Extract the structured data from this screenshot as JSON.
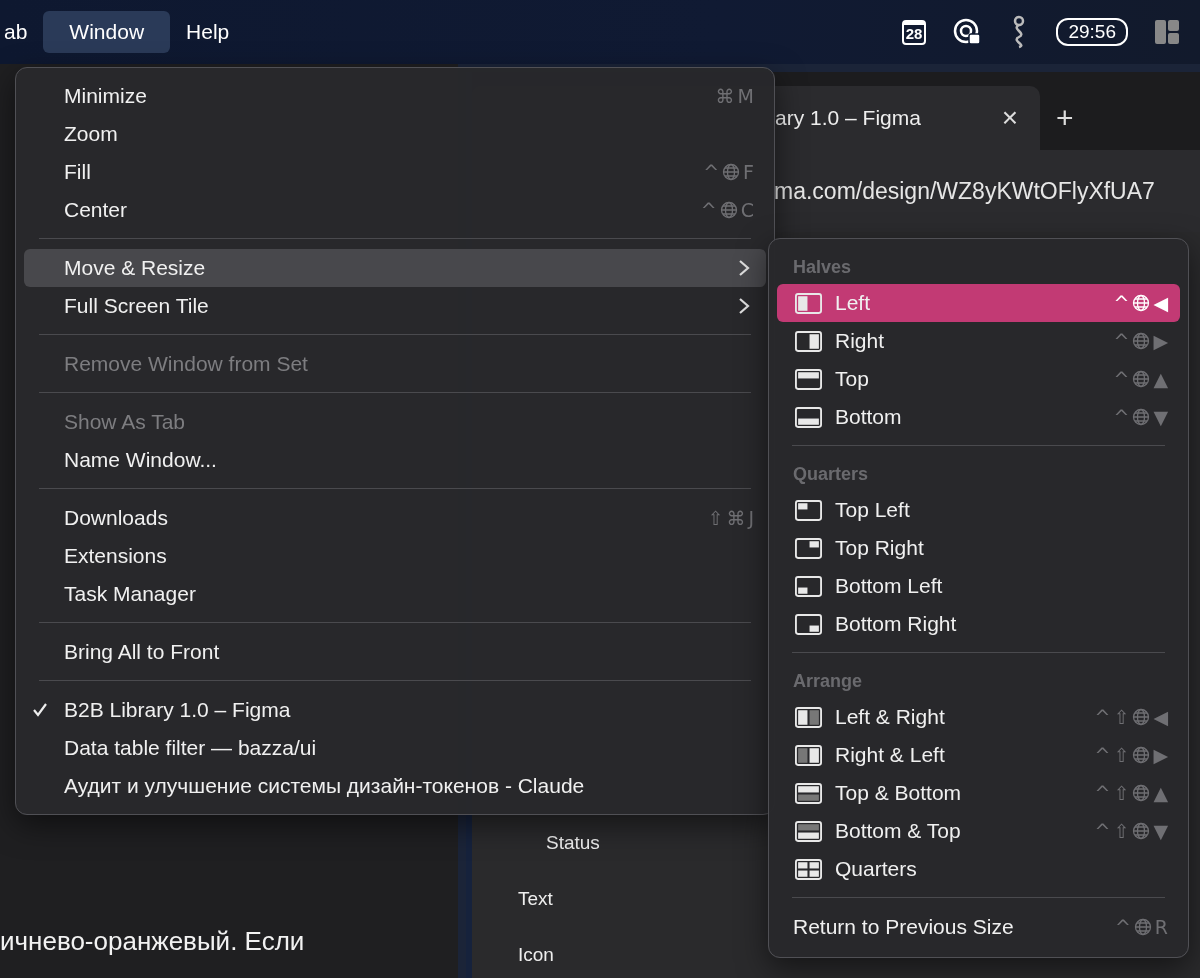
{
  "menu_bar": {
    "items": [
      {
        "label": "ab",
        "selected": false
      },
      {
        "label": "Window",
        "selected": true
      },
      {
        "label": "Help",
        "selected": false
      }
    ],
    "status": {
      "calendar_day": "28",
      "timer": "29:56"
    }
  },
  "browser": {
    "tab": {
      "title": "ary 1.0 – Figma",
      "close": "×"
    },
    "new_tab": "+",
    "url": "ma.com/design/WZ8yKWtOFlyXfUA7",
    "layers": [
      {
        "label": "Status",
        "kind": "nested"
      },
      {
        "label": "Text",
        "kind": "top"
      },
      {
        "label": "Icon",
        "kind": "top"
      }
    ]
  },
  "chat": {
    "text": "ичнево-оранжевый. Если"
  },
  "window_menu": [
    {
      "kind": "item",
      "label": "Minimize",
      "disabled": false,
      "checked": false,
      "selected": false,
      "submenu": false,
      "shortcut": [
        {
          "kind": "key",
          "text": "⌘"
        },
        {
          "kind": "key",
          "text": "M"
        }
      ]
    },
    {
      "kind": "item",
      "label": "Zoom",
      "disabled": false,
      "checked": false,
      "selected": false,
      "submenu": false
    },
    {
      "kind": "item",
      "label": "Fill",
      "disabled": false,
      "checked": false,
      "selected": false,
      "submenu": false,
      "shortcut": [
        {
          "kind": "key",
          "text": "^"
        },
        {
          "kind": "globe"
        },
        {
          "kind": "key",
          "text": "F"
        }
      ]
    },
    {
      "kind": "item",
      "label": "Center",
      "disabled": false,
      "checked": false,
      "selected": false,
      "submenu": false,
      "shortcut": [
        {
          "kind": "key",
          "text": "^"
        },
        {
          "kind": "globe"
        },
        {
          "kind": "key",
          "text": "C"
        }
      ]
    },
    {
      "kind": "separator"
    },
    {
      "kind": "item",
      "label": "Move & Resize",
      "disabled": false,
      "checked": false,
      "selected": true,
      "submenu": true
    },
    {
      "kind": "item",
      "label": "Full Screen Tile",
      "disabled": false,
      "checked": false,
      "selected": false,
      "submenu": true
    },
    {
      "kind": "separator"
    },
    {
      "kind": "item",
      "label": "Remove Window from Set",
      "disabled": true,
      "checked": false,
      "selected": false,
      "submenu": false
    },
    {
      "kind": "separator"
    },
    {
      "kind": "item",
      "label": "Show As Tab",
      "disabled": true,
      "checked": false,
      "selected": false,
      "submenu": false
    },
    {
      "kind": "item",
      "label": "Name Window...",
      "disabled": false,
      "checked": false,
      "selected": false,
      "submenu": false
    },
    {
      "kind": "separator"
    },
    {
      "kind": "item",
      "label": "Downloads",
      "disabled": false,
      "checked": false,
      "selected": false,
      "submenu": false,
      "shortcut": [
        {
          "kind": "key",
          "text": "⇧"
        },
        {
          "kind": "key",
          "text": "⌘"
        },
        {
          "kind": "key",
          "text": "J"
        }
      ]
    },
    {
      "kind": "item",
      "label": "Extensions",
      "disabled": false,
      "checked": false,
      "selected": false,
      "submenu": false
    },
    {
      "kind": "item",
      "label": "Task Manager",
      "disabled": false,
      "checked": false,
      "selected": false,
      "submenu": false
    },
    {
      "kind": "separator"
    },
    {
      "kind": "item",
      "label": "Bring All to Front",
      "disabled": false,
      "checked": false,
      "selected": false,
      "submenu": false
    },
    {
      "kind": "separator"
    },
    {
      "kind": "item",
      "label": "B2B Library 1.0 – Figma",
      "disabled": false,
      "checked": true,
      "selected": false,
      "submenu": false
    },
    {
      "kind": "item",
      "label": "Data table filter — bazza/ui",
      "disabled": false,
      "checked": false,
      "selected": false,
      "submenu": false
    },
    {
      "kind": "item",
      "label": "Аудит и улучшение системы дизайн-токенов - Claude",
      "disabled": false,
      "checked": false,
      "selected": false,
      "submenu": false
    }
  ],
  "resize_menu": [
    {
      "kind": "header",
      "label": "Halves"
    },
    {
      "kind": "left",
      "label": "Left",
      "selected": true,
      "shortcut": [
        {
          "kind": "key",
          "text": "^"
        },
        {
          "kind": "globe"
        },
        {
          "kind": "key",
          "text": "◀"
        }
      ]
    },
    {
      "kind": "right",
      "label": "Right",
      "selected": false,
      "shortcut": [
        {
          "kind": "key",
          "text": "^"
        },
        {
          "kind": "globe"
        },
        {
          "kind": "key",
          "text": "▶"
        }
      ]
    },
    {
      "kind": "top",
      "label": "Top",
      "selected": false,
      "shortcut": [
        {
          "kind": "key",
          "text": "^"
        },
        {
          "kind": "globe"
        },
        {
          "kind": "key",
          "text": "▲"
        }
      ]
    },
    {
      "kind": "bottom",
      "label": "Bottom",
      "selected": false,
      "shortcut": [
        {
          "kind": "key",
          "text": "^"
        },
        {
          "kind": "globe"
        },
        {
          "kind": "key",
          "text": "▼"
        }
      ]
    },
    {
      "kind": "separator"
    },
    {
      "kind": "header",
      "label": "Quarters"
    },
    {
      "kind": "top-left",
      "label": "Top Left",
      "selected": false
    },
    {
      "kind": "top-right",
      "label": "Top Right",
      "selected": false
    },
    {
      "kind": "bottom-left",
      "label": "Bottom Left",
      "selected": false
    },
    {
      "kind": "bottom-right",
      "label": "Bottom Right",
      "selected": false
    },
    {
      "kind": "separator"
    },
    {
      "kind": "header",
      "label": "Arrange"
    },
    {
      "kind": "left-right",
      "label": "Left & Right",
      "selected": false,
      "shortcut": [
        {
          "kind": "key",
          "text": "^"
        },
        {
          "kind": "key",
          "text": "⇧"
        },
        {
          "kind": "globe"
        },
        {
          "kind": "key",
          "text": "◀"
        }
      ]
    },
    {
      "kind": "right-left",
      "label": "Right & Left",
      "selected": false,
      "shortcut": [
        {
          "kind": "key",
          "text": "^"
        },
        {
          "kind": "key",
          "text": "⇧"
        },
        {
          "kind": "globe"
        },
        {
          "kind": "key",
          "text": "▶"
        }
      ]
    },
    {
      "kind": "top-bottom",
      "label": "Top & Bottom",
      "selected": false,
      "shortcut": [
        {
          "kind": "key",
          "text": "^"
        },
        {
          "kind": "key",
          "text": "⇧"
        },
        {
          "kind": "globe"
        },
        {
          "kind": "key",
          "text": "▲"
        }
      ]
    },
    {
      "kind": "bottom-top",
      "label": "Bottom & Top",
      "selected": false,
      "shortcut": [
        {
          "kind": "key",
          "text": "^"
        },
        {
          "kind": "key",
          "text": "⇧"
        },
        {
          "kind": "globe"
        },
        {
          "kind": "key",
          "text": "▼"
        }
      ]
    },
    {
      "kind": "quarters",
      "label": "Quarters",
      "selected": false
    },
    {
      "kind": "separator"
    },
    {
      "kind": "plain",
      "label": "Return to Previous Size",
      "selected": false,
      "shortcut": [
        {
          "kind": "key",
          "text": "^"
        },
        {
          "kind": "globe"
        },
        {
          "kind": "key",
          "text": "R"
        }
      ]
    }
  ]
}
